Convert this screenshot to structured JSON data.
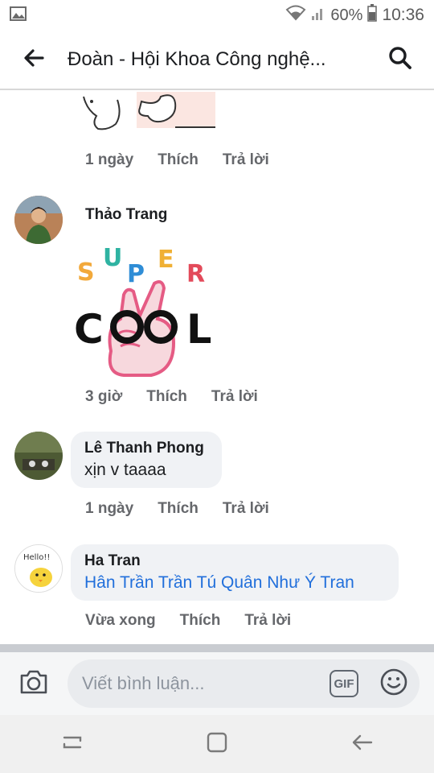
{
  "status_bar": {
    "battery": "60%",
    "time": "10:36"
  },
  "header": {
    "title": "Đoàn - Hội Khoa Công nghệ..."
  },
  "comments": [
    {
      "meta": {
        "time": "1 ngày",
        "like": "Thích",
        "reply": "Trả lời"
      }
    },
    {
      "name": "Thảo Trang",
      "sticker_text": [
        "S",
        "U",
        "P",
        "E",
        "R",
        "C",
        "O",
        "O",
        "L"
      ],
      "meta": {
        "time": "3 giờ",
        "like": "Thích",
        "reply": "Trả lời"
      }
    },
    {
      "name": "Lê Thanh Phong",
      "text": "xịn v taaaa",
      "meta": {
        "time": "1 ngày",
        "like": "Thích",
        "reply": "Trả lời"
      }
    },
    {
      "name": "Ha Tran",
      "avatar_text": "Hello!!",
      "text": "Hân Trần Trần Tú Quân Như Ý Tran",
      "meta": {
        "time": "Vừa xong",
        "like": "Thích",
        "reply": "Trả lời"
      }
    }
  ],
  "composer": {
    "placeholder": "Viết bình luận...",
    "gif_label": "GIF"
  },
  "colors": {
    "link": "#216fdb",
    "meta": "#65676b",
    "bubble": "#f0f2f5"
  }
}
